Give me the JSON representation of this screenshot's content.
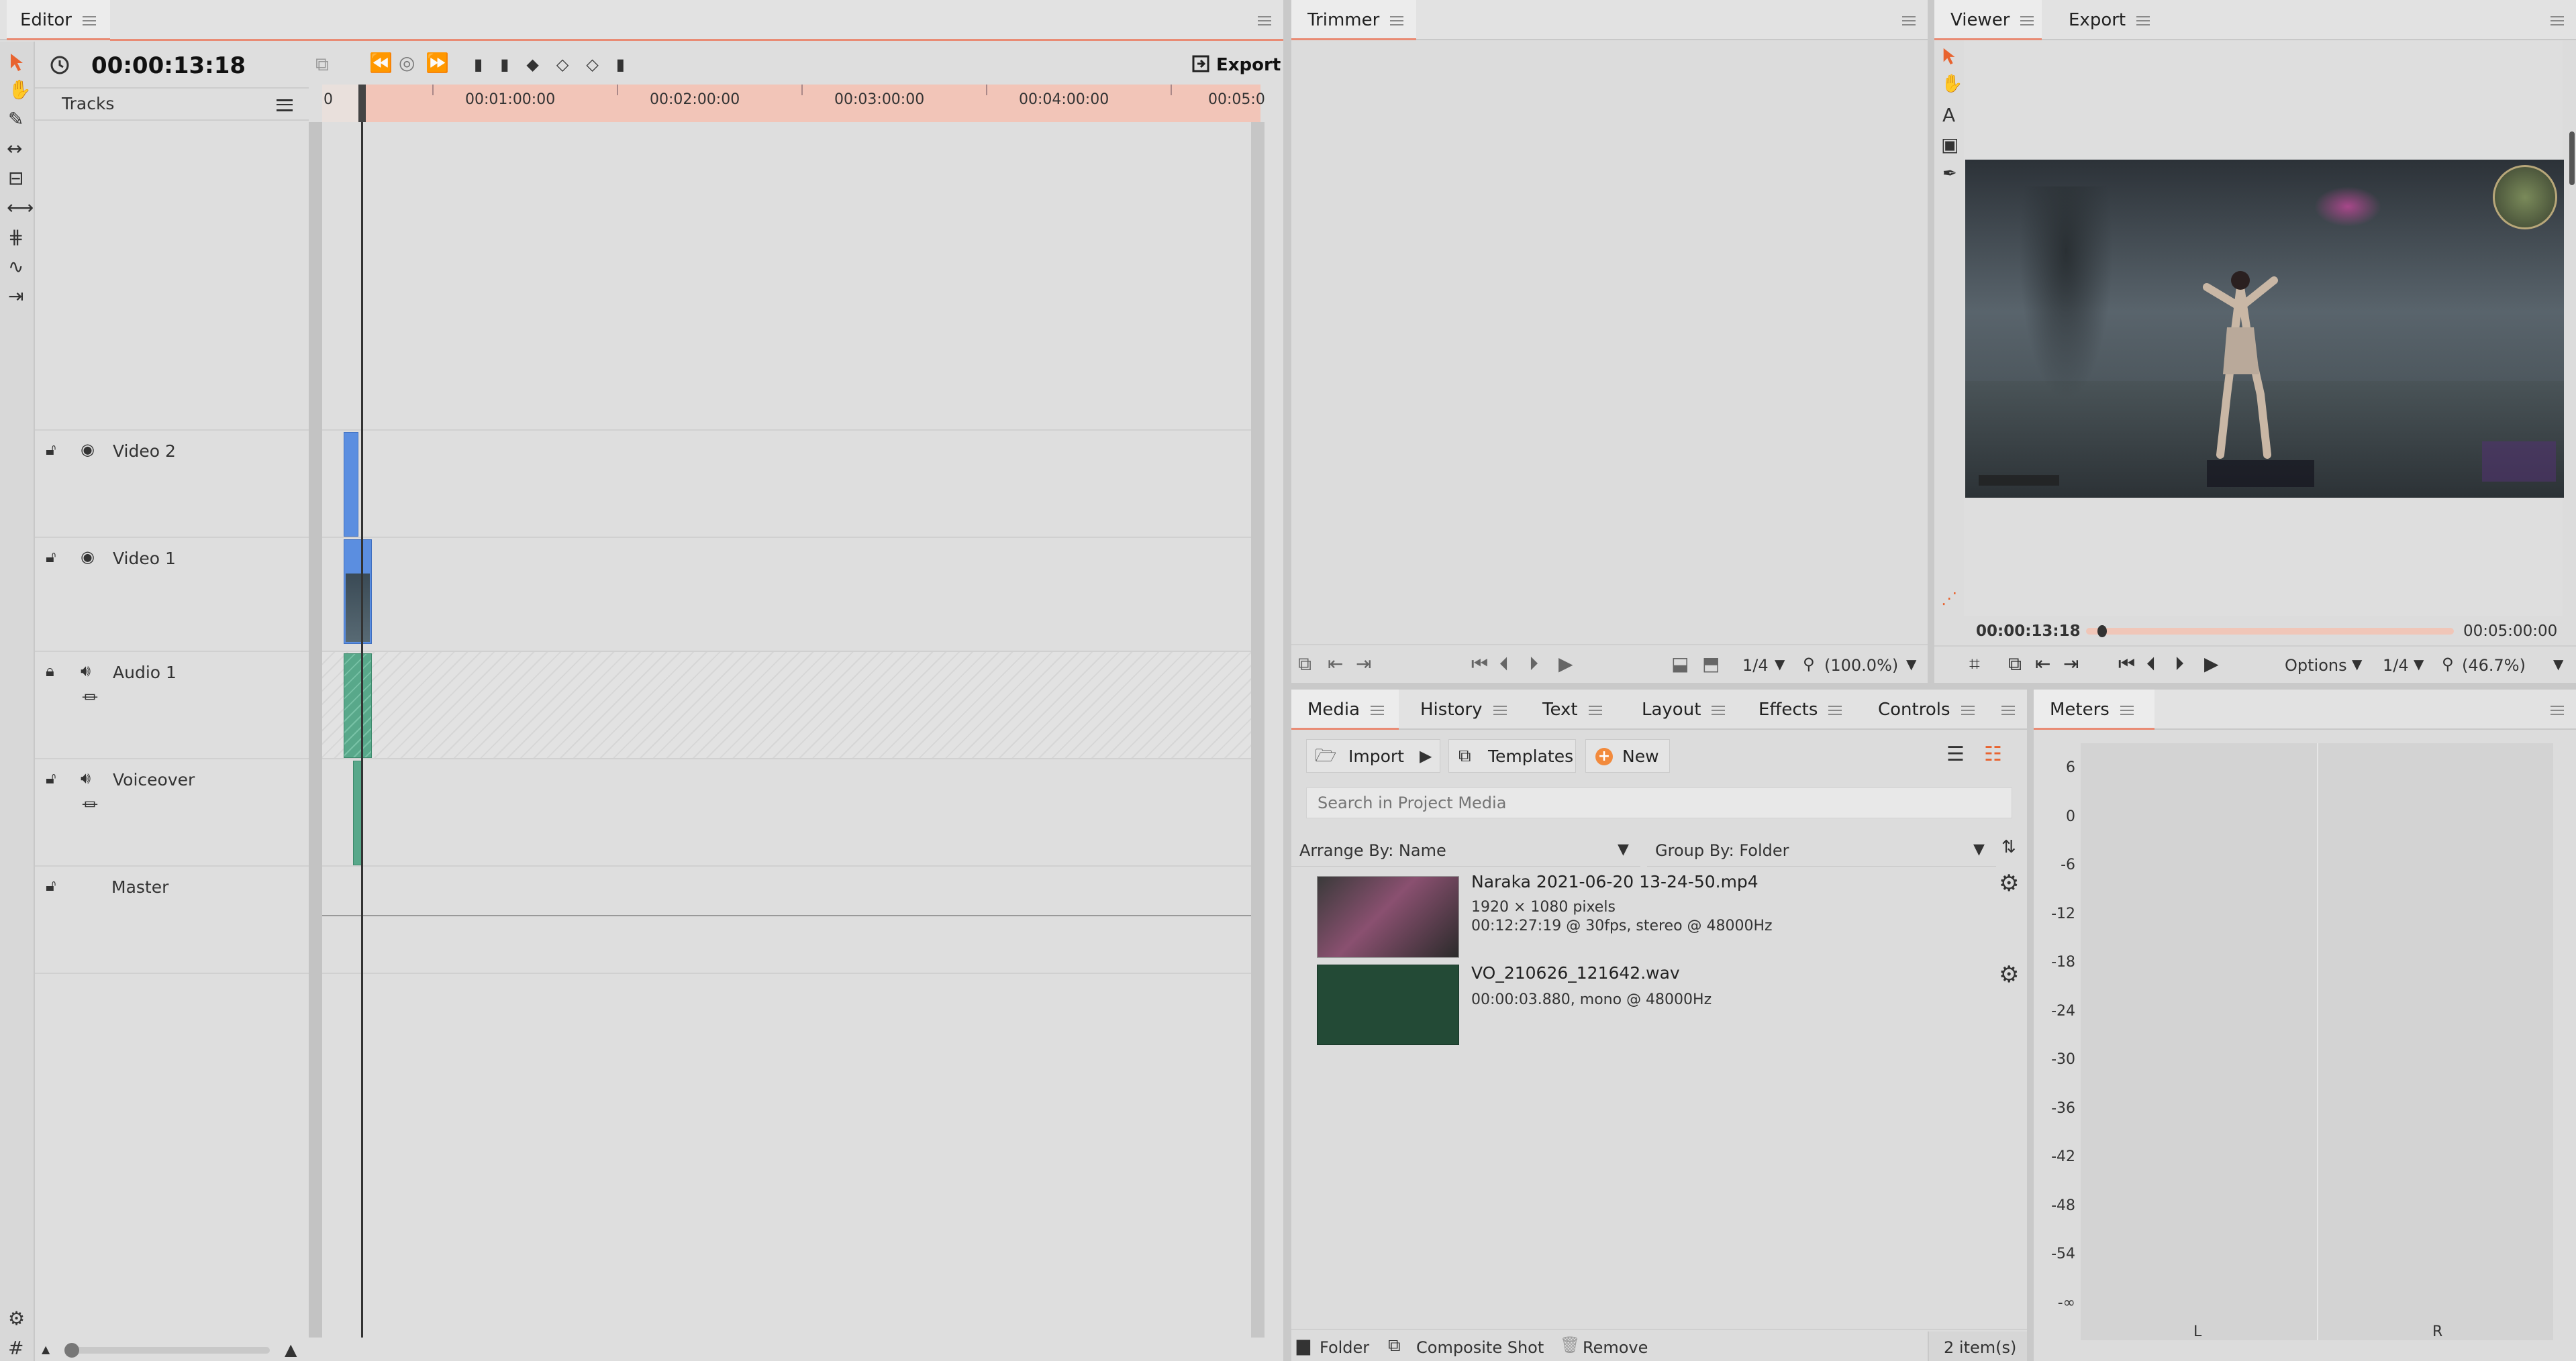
{
  "editor": {
    "tab": "Editor",
    "timecode": "00:00:13:18",
    "export_label": "Export",
    "tracks_label": "Tracks",
    "ruler_ticks": [
      "0",
      "00:01:00:00",
      "00:02:00:00",
      "00:03:00:00",
      "00:04:00:00",
      "00:05:0"
    ],
    "tracks": [
      {
        "name": "Video 2",
        "locked": false,
        "visible": true
      },
      {
        "name": "Video 1",
        "locked": false,
        "visible": true
      },
      {
        "name": "Audio 1",
        "locked": true,
        "audio": true
      },
      {
        "name": "Voiceover",
        "locked": false,
        "audio": true
      },
      {
        "name": "Master",
        "locked": false
      }
    ],
    "tools": [
      "pointer-icon",
      "hand-icon",
      "razor-icon",
      "slip-icon",
      "slide-icon",
      "ripple-icon",
      "roll-icon",
      "curve-icon",
      "insert-icon"
    ]
  },
  "trimmer": {
    "tab": "Trimmer",
    "resolution": "1/4",
    "zoom": "(100.0%)"
  },
  "viewer": {
    "tabs": [
      "Viewer",
      "Export"
    ],
    "current_time": "00:00:13:18",
    "total_time": "00:05:00:00",
    "options_label": "Options",
    "resolution": "1/4",
    "zoom": "(46.7%)",
    "playhead_fraction": 0.044
  },
  "media": {
    "tabs": [
      "Media",
      "History",
      "Text",
      "Layout",
      "Effects",
      "Controls"
    ],
    "import_label": "Import",
    "templates_label": "Templates",
    "new_label": "New",
    "search_placeholder": "Search in Project Media",
    "arrange_by": "Arrange By: Name",
    "group_by": "Group By: Folder",
    "items": [
      {
        "name": "Naraka 2021-06-20 13-24-50.mp4",
        "line1": "1920 × 1080 pixels",
        "line2": "00:12:27:19 @ 30fps, stereo @ 48000Hz"
      },
      {
        "name": "VO_210626_121642.wav",
        "line1": "00:00:03.880, mono @ 48000Hz",
        "line2": ""
      }
    ],
    "footer": {
      "folder": "Folder",
      "composite": "Composite Shot",
      "remove": "Remove",
      "count": "2 item(s)"
    }
  },
  "meters": {
    "tab": "Meters",
    "scale": [
      "6",
      "0",
      "-6",
      "-12",
      "-18",
      "-24",
      "-30",
      "-36",
      "-42",
      "-48",
      "-54",
      "-∞"
    ],
    "channels": [
      "L",
      "R"
    ]
  },
  "colors": {
    "accent": "#e8632f",
    "ruler": "#f2c5b8",
    "video_clip": "#5b8ee0",
    "audio_clip": "#58a88a",
    "vo_thumb": "#234a36"
  }
}
